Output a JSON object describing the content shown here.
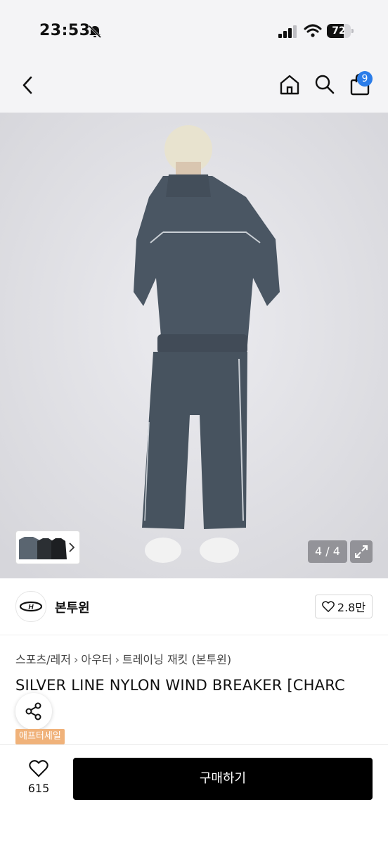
{
  "status_bar": {
    "time": "23:53",
    "battery": "72",
    "battery_level": 0.72
  },
  "nav": {
    "cart_count": "9"
  },
  "gallery": {
    "counter": "4 / 4"
  },
  "brand": {
    "name": "본투윈",
    "likes": "2.8만"
  },
  "breadcrumb": {
    "items": [
      "스포츠/레저",
      "아우터",
      "트레이닝 재킷 (본투윈)"
    ]
  },
  "product": {
    "title": "SILVER LINE NYLON WIND BREAKER [CHARC",
    "tag": "애프터세일"
  },
  "bottom": {
    "like_count": "615",
    "buy_label": "구매하기"
  },
  "colors": {
    "accent": "#2b7de9",
    "tag": "#f0b27a",
    "jacket": "#4a5663",
    "buy": "#000000"
  }
}
